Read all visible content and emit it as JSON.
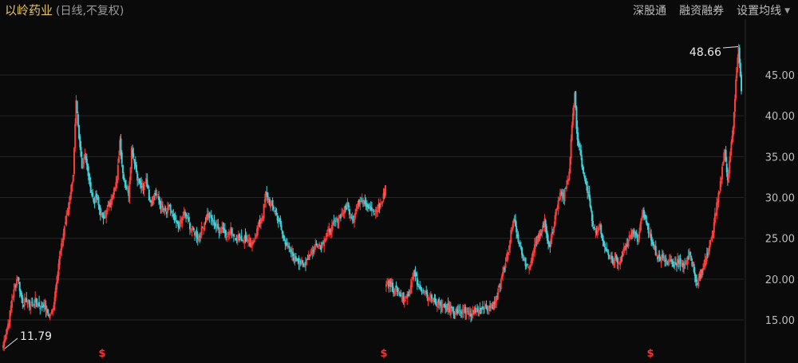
{
  "header": {
    "stock_name": "以岭药业",
    "sub": "(日线,不复权)"
  },
  "toolbar": {
    "shenzhen_connect": "深股通",
    "margin_trading": "融资融券",
    "ma_settings": "设置均线"
  },
  "ma_row_text": "",
  "chart_data": {
    "type": "candlestick",
    "title": "",
    "xlabel": "",
    "ylabel": "",
    "ylim": [
      11.0,
      49.5
    ],
    "y_ticks": [
      "45.00",
      "40.00",
      "35.00",
      "30.00",
      "25.00",
      "20.00",
      "15.00"
    ],
    "y_tick_values": [
      45,
      40,
      35,
      30,
      25,
      20,
      15
    ],
    "grid": true,
    "up_color": "#ff3b3b",
    "down_color": "#3ed1d9",
    "annotations": [
      {
        "label": "48.66",
        "value": 48.66,
        "kind": "max"
      },
      {
        "label": "11.79",
        "value": 11.79,
        "kind": "min"
      }
    ],
    "event_markers": [
      {
        "label": "$",
        "color": "#ff3030"
      },
      {
        "label": "$",
        "color": "#ff3030"
      },
      {
        "label": "$",
        "color": "#ff3030"
      }
    ],
    "segments": [
      {
        "name": "",
        "close": [
          11.9,
          13.5,
          15.0,
          17.5,
          19.0,
          20.5,
          18.0,
          17.0,
          17.5,
          16.8,
          17.0,
          17.3,
          16.9,
          16.5,
          17.0,
          16.0,
          15.5,
          16.2,
          19.0,
          22.0,
          24.0,
          26.5,
          28.0,
          30.5,
          33.0,
          41.5,
          37.0,
          34.0,
          35.5,
          33.0,
          31.0,
          29.5,
          30.0,
          28.5,
          27.5,
          28.0,
          28.8,
          29.5,
          31.5,
          32.0,
          37.0,
          33.0,
          31.5,
          30.5,
          36.0,
          34.5,
          32.5,
          31.5,
          31.0,
          32.5,
          30.0,
          29.5,
          30.5,
          30.0,
          29.0,
          28.5,
          28.0,
          29.0,
          27.5,
          27.0,
          26.5,
          27.0,
          28.0,
          27.5,
          26.5,
          26.0,
          25.5,
          25.0,
          26.0,
          27.0,
          28.0,
          27.5,
          27.0,
          26.5,
          26.0,
          26.5,
          25.8,
          25.5,
          26.0,
          25.5,
          25.0,
          25.2,
          24.8,
          25.0,
          24.5,
          24.0,
          25.0,
          26.0,
          27.0,
          28.0,
          30.5,
          29.5,
          29.0,
          28.5,
          27.5,
          26.5,
          25.0,
          24.5,
          23.5,
          23.0,
          22.5,
          22.5,
          22.0,
          21.5,
          22.5,
          23.0,
          23.5,
          24.0,
          24.5,
          24.0,
          25.0,
          25.5,
          26.0,
          26.5,
          27.0,
          27.5,
          28.0,
          28.5,
          29.0,
          28.0,
          27.5,
          28.5,
          29.5,
          30.0,
          29.5,
          29.0,
          28.5,
          28.0,
          28.5,
          29.0,
          29.5,
          31.5
        ]
      },
      {
        "name": "",
        "close": [
          19.8,
          19.5,
          19.0,
          18.5,
          18.8,
          18.2,
          17.8,
          17.5,
          18.0,
          19.5,
          21.0,
          20.0,
          19.0,
          18.5,
          18.2,
          18.0,
          17.8,
          17.5,
          17.2,
          17.0,
          16.8,
          16.5,
          16.6,
          16.4,
          16.2,
          16.0,
          16.1,
          15.9,
          15.8,
          15.9,
          16.0,
          15.8,
          16.1,
          16.3,
          16.0,
          16.2,
          16.4,
          16.5,
          16.6,
          16.8,
          17.5,
          18.5,
          19.5,
          21.0,
          22.5,
          24.0,
          26.5,
          27.5,
          25.5,
          24.0,
          23.0,
          22.0,
          21.5,
          22.5,
          23.5,
          24.5,
          25.5,
          26.0,
          27.0,
          25.0,
          24.0,
          26.0,
          28.0,
          29.5,
          31.0,
          30.0,
          31.5,
          33.0,
          39.0,
          42.5,
          37.0,
          35.5,
          33.5,
          32.0,
          30.5,
          28.0,
          26.0,
          25.5,
          27.0,
          25.0,
          24.0,
          23.0,
          22.5,
          22.0,
          22.8,
          21.8,
          22.5,
          23.5,
          24.0,
          25.0,
          25.5,
          26.0,
          25.0,
          26.5,
          28.0,
          27.5,
          26.0,
          25.0,
          24.0,
          23.0,
          22.5,
          22.8,
          22.2,
          22.0,
          22.5,
          21.8,
          22.0,
          22.3,
          21.5,
          21.8,
          22.2,
          22.8,
          22.0,
          20.5,
          19.5,
          20.5,
          21.5,
          22.5,
          23.5,
          25.0,
          27.0,
          29.0,
          31.0,
          33.5,
          36.0,
          32.0,
          35.5,
          38.5,
          44.0,
          48.66,
          43.0
        ]
      }
    ]
  }
}
